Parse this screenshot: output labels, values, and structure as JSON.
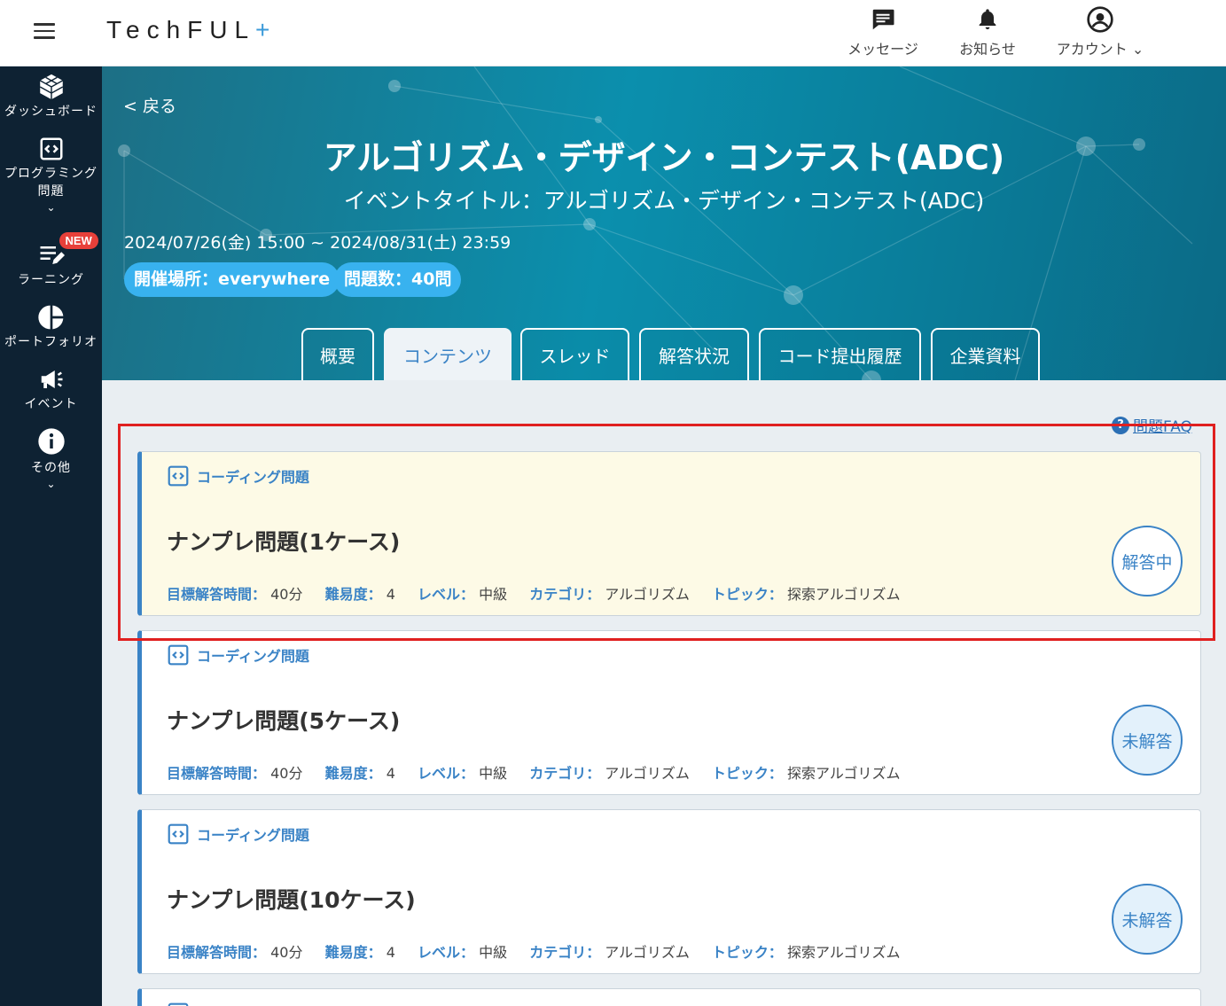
{
  "header": {
    "logo_text": "TechFUL",
    "logo_plus": "+",
    "actions": [
      {
        "label": "メッセージ",
        "icon": "message-icon"
      },
      {
        "label": "お知らせ",
        "icon": "bell-icon"
      },
      {
        "label": "アカウント ⌄",
        "icon": "account-icon"
      }
    ]
  },
  "sidebar": {
    "items": [
      {
        "label": "ダッシュボード",
        "icon": "cube-icon"
      },
      {
        "label": "プログラミング\n問題",
        "icon": "code-icon",
        "chevron": "⌄"
      },
      {
        "label": "ラーニング",
        "icon": "learning-icon",
        "badge": "NEW"
      },
      {
        "label": "ポートフォリオ",
        "icon": "pie-chart-icon"
      },
      {
        "label": "イベント",
        "icon": "megaphone-icon"
      },
      {
        "label": "その他",
        "icon": "info-icon",
        "chevron": "⌄"
      }
    ]
  },
  "banner": {
    "back": "< 戻る",
    "title": "アルゴリズム・デザイン・コンテスト(ADC)",
    "subtitle": "イベントタイトル：アルゴリズム・デザイン・コンテスト(ADC)",
    "date": "2024/07/26(金) 15:00 ~ 2024/08/31(土) 23:59",
    "place": "開催場所：everywhere",
    "count": "問題数：40問",
    "tabs": [
      "概要",
      "コンテンツ",
      "スレッド",
      "解答状況",
      "コード提出履歴",
      "企業資料"
    ],
    "active_tab": "コンテンツ"
  },
  "content": {
    "faq": "問題FAQ",
    "faq_icon": "?",
    "meta_keys": {
      "time": "目標解答時間：",
      "difficulty": "難易度：",
      "level": "レベル：",
      "category": "カテゴリ：",
      "topic": "トピック："
    },
    "cards": [
      {
        "type": "コーディング問題",
        "title": "ナンプレ問題(1ケース)",
        "time": "40分",
        "difficulty": "4",
        "level": "中級",
        "category": "アルゴリズム",
        "topic": "探索アルゴリズム",
        "status": "解答中"
      },
      {
        "type": "コーディング問題",
        "title": "ナンプレ問題(5ケース)",
        "time": "40分",
        "difficulty": "4",
        "level": "中級",
        "category": "アルゴリズム",
        "topic": "探索アルゴリズム",
        "status": "未解答"
      },
      {
        "type": "コーディング問題",
        "title": "ナンプレ問題(10ケース)",
        "time": "40分",
        "difficulty": "4",
        "level": "中級",
        "category": "アルゴリズム",
        "topic": "探索アルゴリズム",
        "status": "未解答"
      }
    ]
  },
  "colors": {
    "accent": "#3a83c6",
    "sidebar": "#0e2233",
    "banner": "#0b8fad",
    "pill": "#38b2ef",
    "highlight": "#e02020",
    "new_badge": "#e8403a"
  }
}
